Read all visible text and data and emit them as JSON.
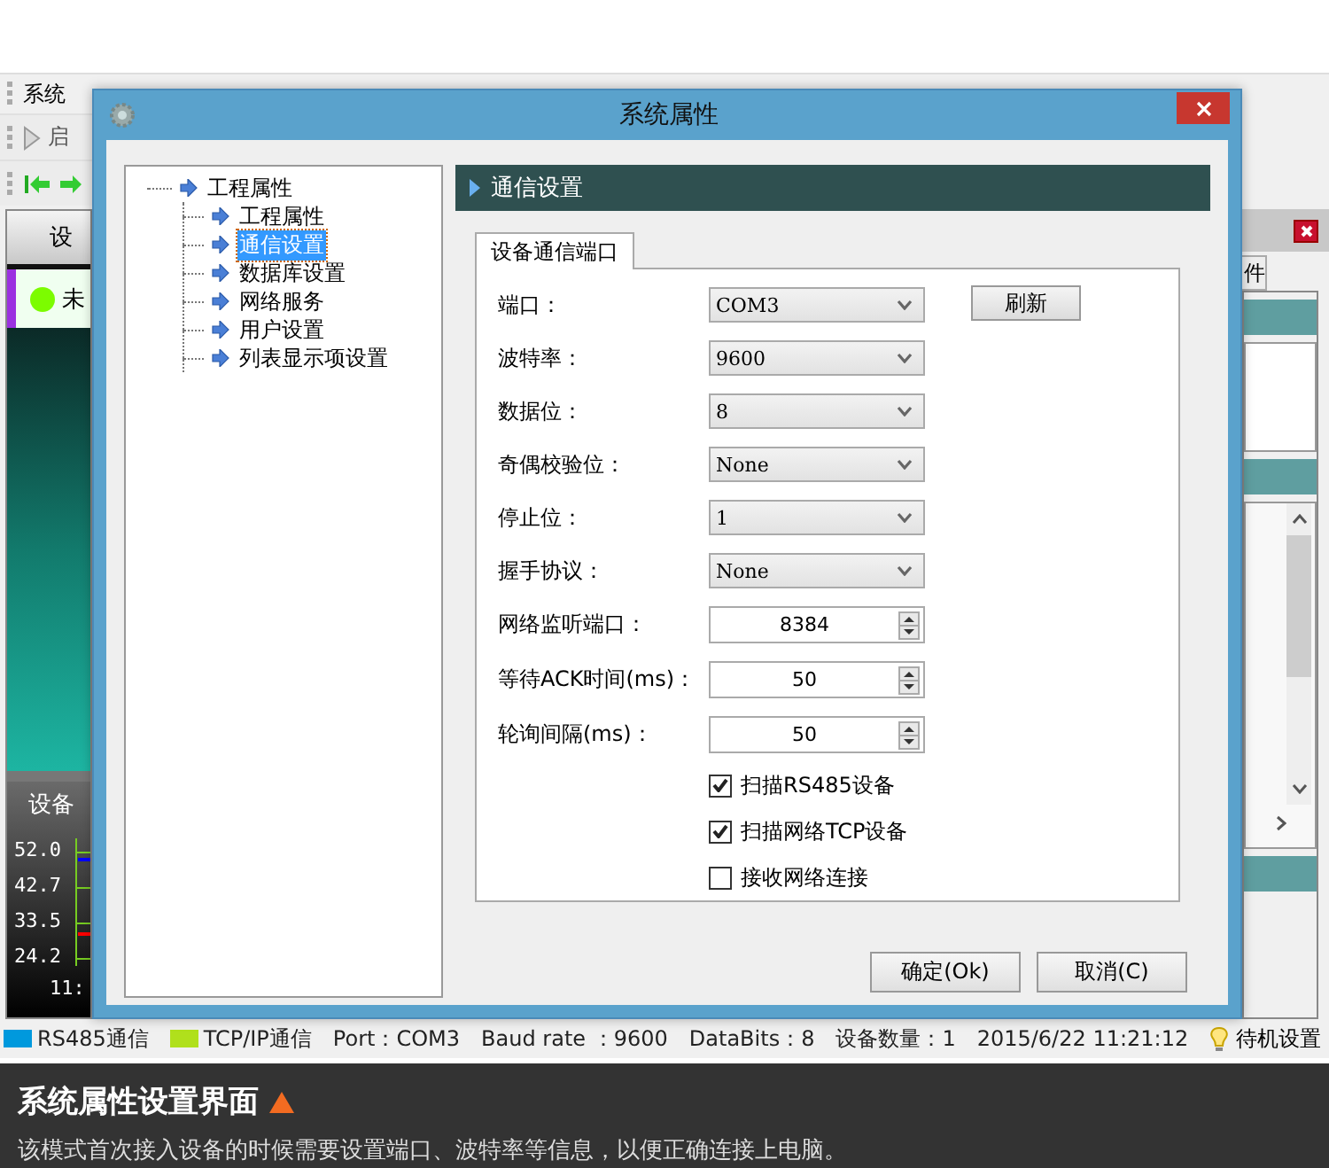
{
  "background_app": {
    "menu": "系统",
    "toolbar_label": "启",
    "device_panel": {
      "header": "设",
      "devices": [
        {
          "name": "未"
        }
      ]
    },
    "chart_panel": {
      "title": "设备",
      "y_labels": [
        "52.0",
        "42.7",
        "33.5",
        "24.2"
      ],
      "time_label": "11:"
    },
    "side_tab": "件"
  },
  "dialog": {
    "title": "系统属性",
    "tree": [
      {
        "label": "工程属性",
        "selected": false,
        "children": [
          {
            "label": "工程属性",
            "selected": false
          },
          {
            "label": "通信设置",
            "selected": true
          },
          {
            "label": "数据库设置",
            "selected": false
          },
          {
            "label": "网络服务",
            "selected": false
          },
          {
            "label": "用户设置",
            "selected": false
          },
          {
            "label": "列表显示项设置",
            "selected": false
          }
        ]
      }
    ],
    "section_header": "通信设置",
    "tabs": [
      {
        "label": "设备通信端口",
        "selected": true
      }
    ],
    "fields": [
      {
        "kind": "select",
        "label": "端口：",
        "value": "COM3",
        "action": "刷新"
      },
      {
        "kind": "select",
        "label": "波特率：",
        "value": "9600"
      },
      {
        "kind": "select",
        "label": "数据位：",
        "value": "8"
      },
      {
        "kind": "select",
        "label": "奇偶校验位：",
        "value": "None"
      },
      {
        "kind": "select",
        "label": "停止位：",
        "value": "1"
      },
      {
        "kind": "select",
        "label": "握手协议：",
        "value": "None"
      },
      {
        "kind": "spin",
        "label": "网络监听端口：",
        "value": "8384"
      },
      {
        "kind": "spin",
        "label": "等待ACK时间(ms)：",
        "value": "50"
      },
      {
        "kind": "spin",
        "label": "轮询间隔(ms)：",
        "value": "50"
      }
    ],
    "checkboxes": [
      {
        "label": "扫描RS485设备",
        "checked": true
      },
      {
        "label": "扫描网络TCP设备",
        "checked": true
      },
      {
        "label": "接收网络连接",
        "checked": false
      }
    ],
    "buttons": [
      "确定(Ok)",
      "取消(C)"
    ]
  },
  "status_bar": {
    "items": [
      {
        "kind": "legend",
        "label": "RS485通信",
        "color": "#0099dd"
      },
      {
        "kind": "legend",
        "label": "TCP/IP通信",
        "color": "#b0e01c"
      },
      {
        "kind": "text",
        "label": "Port：COM3"
      },
      {
        "kind": "text",
        "label": "Baud rate ：9600"
      },
      {
        "kind": "text",
        "label": "DataBits：8"
      },
      {
        "kind": "text",
        "label": "设备数量：1"
      },
      {
        "kind": "text",
        "label": "2015/6/22 11:21:12"
      },
      {
        "kind": "menu",
        "label": "待机设置"
      }
    ]
  },
  "caption": {
    "title": "系统属性设置界面",
    "description": "该模式首次接入设备的时候需要设置端口、波特率等信息，以便正确连接上电脑。"
  }
}
